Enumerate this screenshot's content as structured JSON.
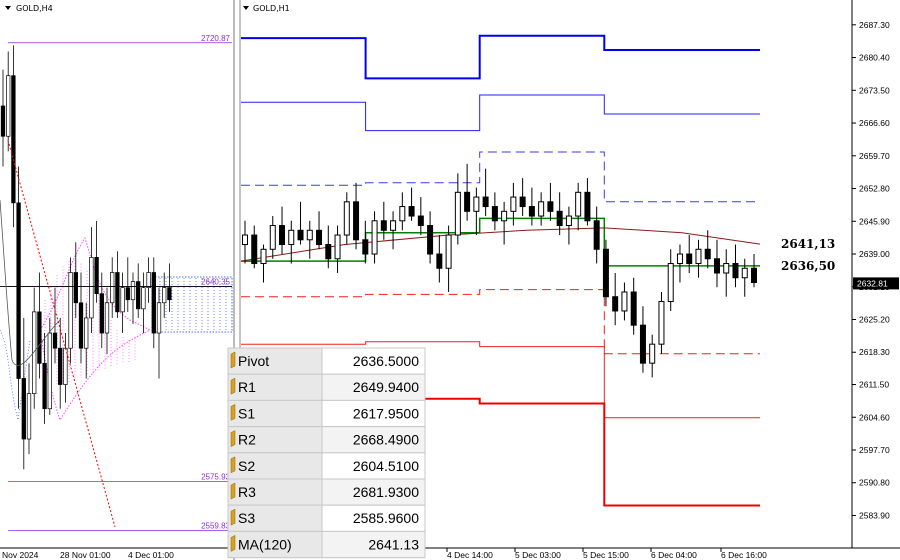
{
  "left_chart": {
    "symbol": "GOLD,H4",
    "price_labels": [
      {
        "text": "2720.87",
        "price": 2720.87,
        "color": "#8a2be2"
      },
      {
        "text": "2640.35",
        "price": 2640.35,
        "color": "#8a2be2"
      },
      {
        "text": "2575.93",
        "price": 2575.93,
        "color": "#8a2be2"
      },
      {
        "text": "2559.83",
        "price": 2559.83,
        "color": "#8a2be2"
      }
    ],
    "time_labels": [
      "Nov 2024",
      "28 Nov 01:00",
      "4 Dec 01:00"
    ]
  },
  "chart_data": {
    "type": "candlestick",
    "symbol": "GOLD,H1",
    "ylim": [
      2580.0,
      2690.0
    ],
    "y_ticks": [
      "2687.30",
      "2680.40",
      "2673.50",
      "2666.60",
      "2659.70",
      "2652.80",
      "2645.90",
      "2639.00",
      "2632.10",
      "2625.20",
      "2618.30",
      "2611.50",
      "2604.60",
      "2597.70",
      "2590.80",
      "2583.90"
    ],
    "x_labels": [
      "4 Dec 14:00",
      "5 Dec 03:00",
      "5 Dec 15:00",
      "6 Dec 04:00",
      "6 Dec 16:00"
    ],
    "current_price": {
      "label": "2632.81",
      "value": 2632.81
    },
    "annotations": [
      {
        "text": "2641,13",
        "value": 2641.13
      },
      {
        "text": "2636,50",
        "value": 2636.5
      }
    ],
    "pivot_levels": [
      {
        "name": "R3",
        "color": "#0000ee",
        "style": "solid",
        "width": 2,
        "steps": [
          [
            0,
            2684.5
          ],
          [
            0.24,
            2684.5
          ],
          [
            0.24,
            2676.0
          ],
          [
            0.46,
            2676.0
          ],
          [
            0.46,
            2685.0
          ],
          [
            0.7,
            2685.0
          ],
          [
            0.7,
            2682.0
          ],
          [
            1,
            2682.0
          ]
        ]
      },
      {
        "name": "R2",
        "color": "#2020ee",
        "style": "solid",
        "width": 1,
        "steps": [
          [
            0,
            2671.0
          ],
          [
            0.24,
            2671.0
          ],
          [
            0.24,
            2665.0
          ],
          [
            0.46,
            2665.0
          ],
          [
            0.46,
            2672.5
          ],
          [
            0.7,
            2672.5
          ],
          [
            0.7,
            2668.5
          ],
          [
            1,
            2668.5
          ]
        ]
      },
      {
        "name": "R1",
        "color": "#3a3aee",
        "style": "dash",
        "width": 1,
        "steps": [
          [
            0,
            2653.5
          ],
          [
            0.24,
            2653.5
          ],
          [
            0.24,
            2654.0
          ],
          [
            0.46,
            2654.0
          ],
          [
            0.46,
            2660.5
          ],
          [
            0.7,
            2660.5
          ],
          [
            0.7,
            2650.0
          ],
          [
            1,
            2650.0
          ]
        ]
      },
      {
        "name": "Pivot",
        "color": "#008000",
        "style": "solid",
        "width": 1.5,
        "steps": [
          [
            0,
            2637.5
          ],
          [
            0.24,
            2637.5
          ],
          [
            0.24,
            2643.5
          ],
          [
            0.46,
            2643.5
          ],
          [
            0.46,
            2646.5
          ],
          [
            0.7,
            2646.5
          ],
          [
            0.7,
            2636.5
          ],
          [
            1,
            2636.5
          ]
        ]
      },
      {
        "name": "S1",
        "color": "#ee2020",
        "style": "dash",
        "width": 1,
        "steps": [
          [
            0,
            2630.0
          ],
          [
            0.24,
            2630.0
          ],
          [
            0.24,
            2630.5
          ],
          [
            0.46,
            2630.5
          ],
          [
            0.46,
            2631.5
          ],
          [
            0.7,
            2631.5
          ],
          [
            0.7,
            2618.0
          ],
          [
            1,
            2618.0
          ]
        ]
      },
      {
        "name": "S2",
        "color": "#ee2020",
        "style": "solid",
        "width": 1,
        "steps": [
          [
            0,
            2620.0
          ],
          [
            0.24,
            2620.0
          ],
          [
            0.24,
            2620.5
          ],
          [
            0.46,
            2620.5
          ],
          [
            0.46,
            2619.5
          ],
          [
            0.7,
            2619.5
          ],
          [
            0.7,
            2604.5
          ],
          [
            1,
            2604.5
          ]
        ]
      },
      {
        "name": "S3",
        "color": "#ee0000",
        "style": "solid",
        "width": 2,
        "steps": [
          [
            0,
            2609.0
          ],
          [
            0.24,
            2609.0
          ],
          [
            0.24,
            2608.5
          ],
          [
            0.46,
            2608.5
          ],
          [
            0.46,
            2607.5
          ],
          [
            0.7,
            2607.5
          ],
          [
            0.7,
            2586.0
          ],
          [
            1,
            2586.0
          ]
        ]
      }
    ],
    "ma_label": "MA(120)",
    "ma": [
      [
        0,
        2637.5
      ],
      [
        0.2,
        2641.0
      ],
      [
        0.4,
        2643.0
      ],
      [
        0.55,
        2644.0
      ],
      [
        0.7,
        2644.5
      ],
      [
        0.85,
        2643.5
      ],
      [
        1,
        2641.1
      ]
    ],
    "candles": [
      [
        2641,
        2646,
        2637,
        2643
      ],
      [
        2643,
        2645,
        2636,
        2637
      ],
      [
        2637,
        2641,
        2633,
        2640
      ],
      [
        2640,
        2647,
        2638,
        2645
      ],
      [
        2645,
        2649,
        2639,
        2641
      ],
      [
        2641,
        2646,
        2637,
        2644
      ],
      [
        2644,
        2650,
        2641,
        2642
      ],
      [
        2642,
        2646,
        2638,
        2644
      ],
      [
        2644,
        2648,
        2640,
        2641
      ],
      [
        2641,
        2645,
        2636,
        2638
      ],
      [
        2638,
        2645,
        2635,
        2643
      ],
      [
        2643,
        2652,
        2641,
        2650
      ],
      [
        2650,
        2654,
        2640,
        2642
      ],
      [
        2642,
        2646,
        2637,
        2639
      ],
      [
        2639,
        2648,
        2637,
        2646
      ],
      [
        2646,
        2650,
        2642,
        2644
      ],
      [
        2644,
        2648,
        2640,
        2646
      ],
      [
        2646,
        2652,
        2644,
        2649
      ],
      [
        2649,
        2653,
        2646,
        2647
      ],
      [
        2647,
        2651,
        2643,
        2645
      ],
      [
        2645,
        2648,
        2637,
        2639
      ],
      [
        2639,
        2643,
        2633,
        2636
      ],
      [
        2636,
        2645,
        2631,
        2643
      ],
      [
        2643,
        2656,
        2641,
        2652
      ],
      [
        2652,
        2658,
        2646,
        2648
      ],
      [
        2648,
        2653,
        2643,
        2651
      ],
      [
        2651,
        2657,
        2647,
        2649
      ],
      [
        2649,
        2652,
        2644,
        2646
      ],
      [
        2646,
        2650,
        2641,
        2648
      ],
      [
        2648,
        2654,
        2645,
        2651
      ],
      [
        2651,
        2655,
        2647,
        2649
      ],
      [
        2649,
        2653,
        2645,
        2647
      ],
      [
        2647,
        2652,
        2645,
        2650
      ],
      [
        2650,
        2654,
        2646,
        2648
      ],
      [
        2648,
        2652,
        2643,
        2645
      ],
      [
        2645,
        2649,
        2641,
        2647
      ],
      [
        2647,
        2654,
        2644,
        2652
      ],
      [
        2652,
        2655,
        2645,
        2646
      ],
      [
        2646,
        2649,
        2637,
        2640
      ],
      [
        2640,
        2642,
        2628,
        2630
      ],
      [
        2630,
        2635,
        2624,
        2627
      ],
      [
        2627,
        2633,
        2625,
        2631
      ],
      [
        2631,
        2634,
        2622,
        2624
      ],
      [
        2624,
        2628,
        2614,
        2616
      ],
      [
        2616,
        2622,
        2613,
        2620
      ],
      [
        2620,
        2631,
        2618,
        2629
      ],
      [
        2629,
        2640,
        2627,
        2637
      ],
      [
        2637,
        2641,
        2633,
        2639
      ],
      [
        2639,
        2643,
        2635,
        2637
      ],
      [
        2637,
        2642,
        2634,
        2640
      ],
      [
        2640,
        2644,
        2636,
        2638
      ],
      [
        2638,
        2642,
        2632,
        2635
      ],
      [
        2635,
        2640,
        2630,
        2637
      ],
      [
        2637,
        2641,
        2632,
        2634
      ],
      [
        2634,
        2638,
        2630,
        2636
      ],
      [
        2636,
        2639,
        2632,
        2633
      ]
    ],
    "pivot_table": [
      {
        "label": "Pivot",
        "value": "2636.5000"
      },
      {
        "label": "R1",
        "value": "2649.9400"
      },
      {
        "label": "S1",
        "value": "2617.9500"
      },
      {
        "label": "R2",
        "value": "2668.4900"
      },
      {
        "label": "S2",
        "value": "2604.5100"
      },
      {
        "label": "R3",
        "value": "2681.9300"
      },
      {
        "label": "S3",
        "value": "2585.9600"
      },
      {
        "label": "MA(120)",
        "value": "2641.13"
      }
    ]
  }
}
